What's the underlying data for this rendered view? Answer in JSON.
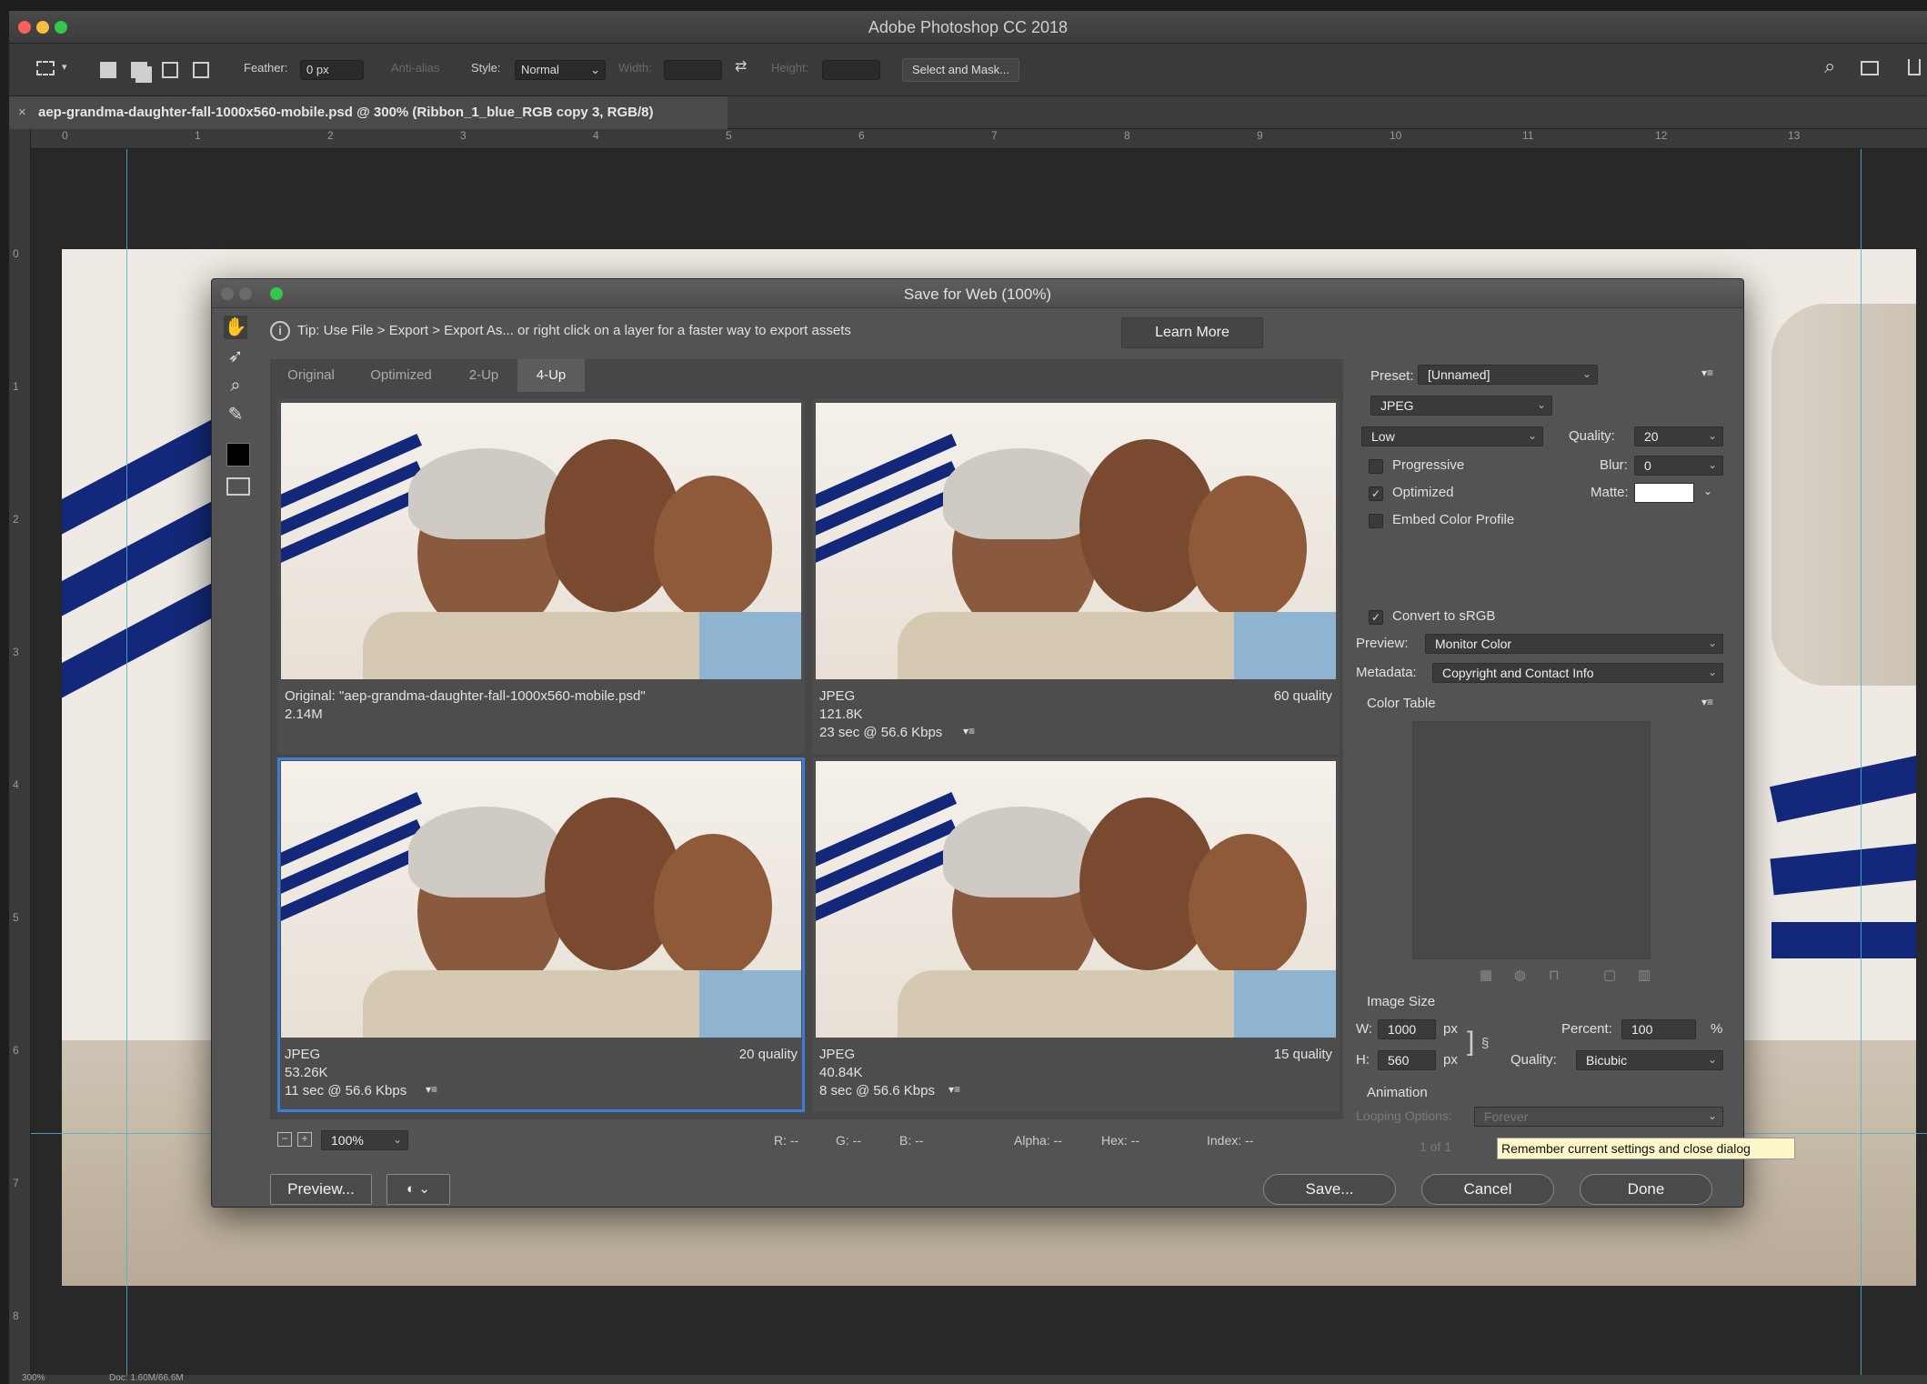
{
  "app": {
    "title": "Adobe Photoshop CC 2018",
    "document_tab": "aep-grandma-daughter-fall-1000x560-mobile.psd @ 300% (Ribbon_1_blue_RGB copy 3, RGB/8)",
    "close_glyph": "×"
  },
  "options_bar": {
    "feather_label": "Feather:",
    "feather_value": "0 px",
    "antialias_label": "Anti-alias",
    "style_label": "Style:",
    "style_value": "Normal",
    "width_label": "Width:",
    "height_label": "Height:",
    "select_mask_label": "Select and Mask..."
  },
  "ruler": {
    "h_labels": [
      "0",
      "1",
      "2",
      "3",
      "4",
      "5",
      "6",
      "7",
      "8",
      "9",
      "10",
      "11",
      "12",
      "13"
    ],
    "v_labels": [
      "0",
      "1",
      "2",
      "3",
      "4",
      "5",
      "6",
      "7",
      "8"
    ]
  },
  "statusbar": {
    "zoom": "300%",
    "doc": "Doc: 1.60M/66.6M"
  },
  "dialog": {
    "title": "Save for Web (100%)",
    "tip": "Tip: Use File > Export > Export As...  or right click on a layer for a faster way to export assets",
    "learn_more": "Learn More",
    "tabs": [
      "Original",
      "Optimized",
      "2-Up",
      "4-Up"
    ],
    "active_tab": "4-Up",
    "panes": [
      {
        "line1": "Original: \"aep-grandma-daughter-fall-1000x560-mobile.psd\"",
        "line2": "2.14M",
        "line3": "",
        "quality": ""
      },
      {
        "line1": "JPEG",
        "line2": "121.8K",
        "line3": "23 sec @ 56.6 Kbps",
        "quality": "60 quality"
      },
      {
        "line1": "JPEG",
        "line2": "53.26K",
        "line3": "11 sec @ 56.6 Kbps",
        "quality": "20 quality"
      },
      {
        "line1": "JPEG",
        "line2": "40.84K",
        "line3": "8 sec @ 56.6 Kbps",
        "quality": "15 quality"
      }
    ],
    "bottom": {
      "zoom": "100%",
      "r": "R: --",
      "g": "G: --",
      "b": "B: --",
      "alpha": "Alpha: --",
      "hex": "Hex: --",
      "index": "Index: --"
    },
    "buttons": {
      "preview": "Preview...",
      "save": "Save...",
      "cancel": "Cancel",
      "done": "Done"
    },
    "tooltip": "Remember current settings and close dialog",
    "settings": {
      "preset_label": "Preset:",
      "preset_value": "[Unnamed]",
      "format": "JPEG",
      "compression": "Low",
      "quality_label": "Quality:",
      "quality_value": "20",
      "progressive": "Progressive",
      "blur_label": "Blur:",
      "blur_value": "0",
      "optimized": "Optimized",
      "matte_label": "Matte:",
      "embed": "Embed Color Profile",
      "convert": "Convert to sRGB",
      "preview_label": "Preview:",
      "preview_value": "Monitor Color",
      "metadata_label": "Metadata:",
      "metadata_value": "Copyright and Contact Info",
      "color_table": "Color Table",
      "image_size": "Image Size",
      "w_label": "W:",
      "w_value": "1000",
      "h_label": "H:",
      "h_value": "560",
      "px": "px",
      "percent_label": "Percent:",
      "percent_value": "100",
      "percent_sign": "%",
      "resample_label": "Quality:",
      "resample_value": "Bicubic",
      "animation": "Animation",
      "looping_label": "Looping Options:",
      "looping_value": "Forever",
      "frame": "1 of 1"
    }
  },
  "colors": {
    "accent_blue": "#3c7dd6",
    "ribbon_blue": "#13287a",
    "tooltip_bg": "#fbf7c9"
  }
}
